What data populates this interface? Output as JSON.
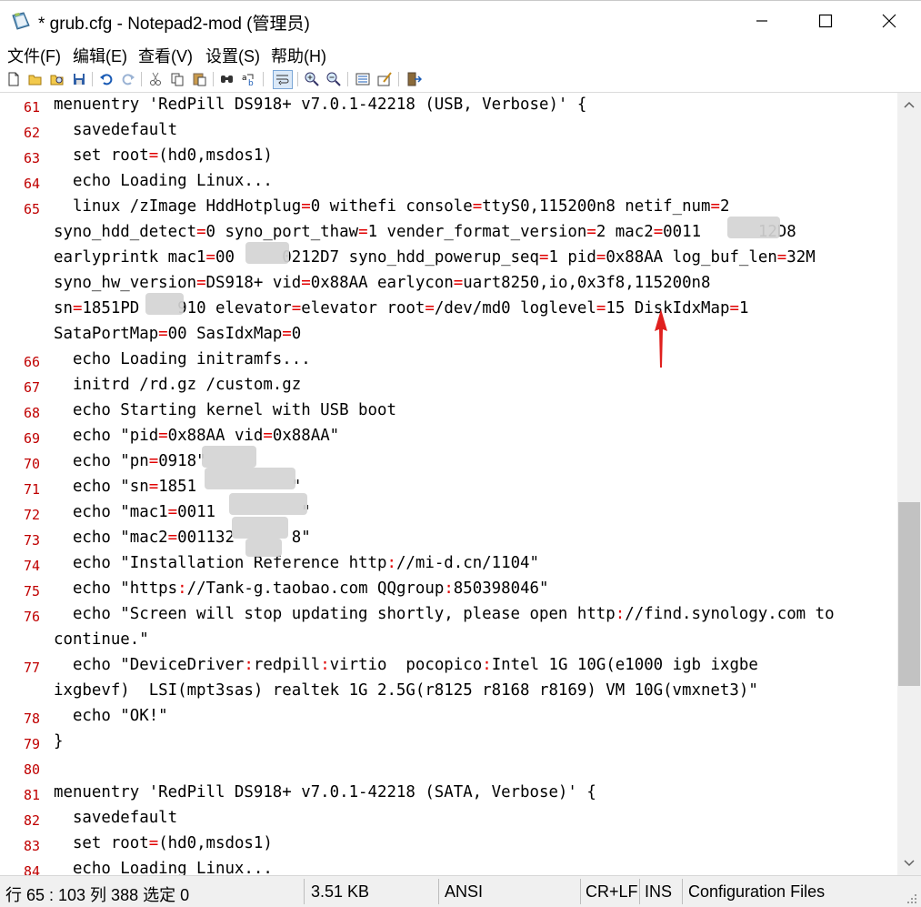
{
  "window": {
    "title": "* grub.cfg - Notepad2-mod (管理员)",
    "app_icon": "notepad-icon"
  },
  "menu": [
    "文件(F)",
    "编辑(E)",
    "查看(V)",
    "设置(S)",
    "帮助(H)"
  ],
  "toolbar": [
    "new-file-icon",
    "open-icon",
    "browse-icon",
    "save-icon",
    "undo-icon",
    "redo-icon",
    "cut-icon",
    "copy-icon",
    "paste-icon",
    "find-icon",
    "replace-icon",
    "word-wrap-icon",
    "zoom-in-icon",
    "zoom-out-icon",
    "scheme-icon",
    "customize-icon",
    "exit-icon"
  ],
  "editor": {
    "lines": [
      {
        "n": "61",
        "t": "menuentry 'RedPill DS918+ v7.0.1-42218 (USB, Verbose)' {"
      },
      {
        "n": "62",
        "t": "  savedefault"
      },
      {
        "n": "63",
        "t": "  set root=(hd0,msdos1)"
      },
      {
        "n": "64",
        "t": "  echo Loading Linux..."
      },
      {
        "n": "65",
        "t": "  linux /zImage HddHotplug=0 withefi console=ttyS0,115200n8 netif_num=2"
      },
      {
        "n": "",
        "t": "syno_hdd_detect=0 syno_port_thaw=1 vender_format_version=2 mac2=0011      12D8"
      },
      {
        "n": "",
        "t": "earlyprintk mac1=00     0212D7 syno_hdd_powerup_seq=1 pid=0x88AA log_buf_len=32M"
      },
      {
        "n": "",
        "t": "syno_hw_version=DS918+ vid=0x88AA earlycon=uart8250,io,0x3f8,115200n8"
      },
      {
        "n": "",
        "t": "sn=1851PD    910 elevator=elevator root=/dev/md0 loglevel=15 DiskIdxMap=1"
      },
      {
        "n": "",
        "t": "SataPortMap=00 SasIdxMap=0"
      },
      {
        "n": "66",
        "t": "  echo Loading initramfs..."
      },
      {
        "n": "67",
        "t": "  initrd /rd.gz /custom.gz"
      },
      {
        "n": "68",
        "t": "  echo Starting kernel with USB boot"
      },
      {
        "n": "69",
        "t": "  echo \"pid=0x88AA vid=0x88AA\""
      },
      {
        "n": "70",
        "t": "  echo \"pn=0918\""
      },
      {
        "n": "71",
        "t": "  echo \"sn=1851          \""
      },
      {
        "n": "72",
        "t": "  echo \"mac1=0011         \""
      },
      {
        "n": "73",
        "t": "  echo \"mac2=001132      8\""
      },
      {
        "n": "74",
        "t": "  echo \"Installation Reference http://mi-d.cn/1104\""
      },
      {
        "n": "75",
        "t": "  echo \"https://Tank-g.taobao.com QQgroup:850398046\""
      },
      {
        "n": "76",
        "t": "  echo \"Screen will stop updating shortly, please open http://find.synology.com to"
      },
      {
        "n": "",
        "t": "continue.\""
      },
      {
        "n": "77",
        "t": "  echo \"DeviceDriver:redpill:virtio  pocopico:Intel 1G 10G(e1000 igb ixgbe"
      },
      {
        "n": "",
        "t": "ixgbevf)  LSI(mpt3sas) realtek 1G 2.5G(r8125 r8168 r8169) VM 10G(vmxnet3)\""
      },
      {
        "n": "78",
        "t": "  echo \"OK!\""
      },
      {
        "n": "79",
        "t": "}"
      },
      {
        "n": "80",
        "t": ""
      },
      {
        "n": "81",
        "t": "menuentry 'RedPill DS918+ v7.0.1-42218 (SATA, Verbose)' {"
      },
      {
        "n": "82",
        "t": "  savedefault"
      },
      {
        "n": "83",
        "t": "  set root=(hd0,msdos1)"
      },
      {
        "n": "84",
        "t": "  echo Loading Linux..."
      }
    ]
  },
  "statusbar": {
    "position": "行 65 : 103   列 388   选定 0",
    "size": "3.51 KB",
    "encoding": "ANSI",
    "eol": "CR+LF",
    "ins": "INS",
    "scheme": "Configuration Files"
  },
  "annotation": {
    "arrow_color": "#e0201e"
  }
}
